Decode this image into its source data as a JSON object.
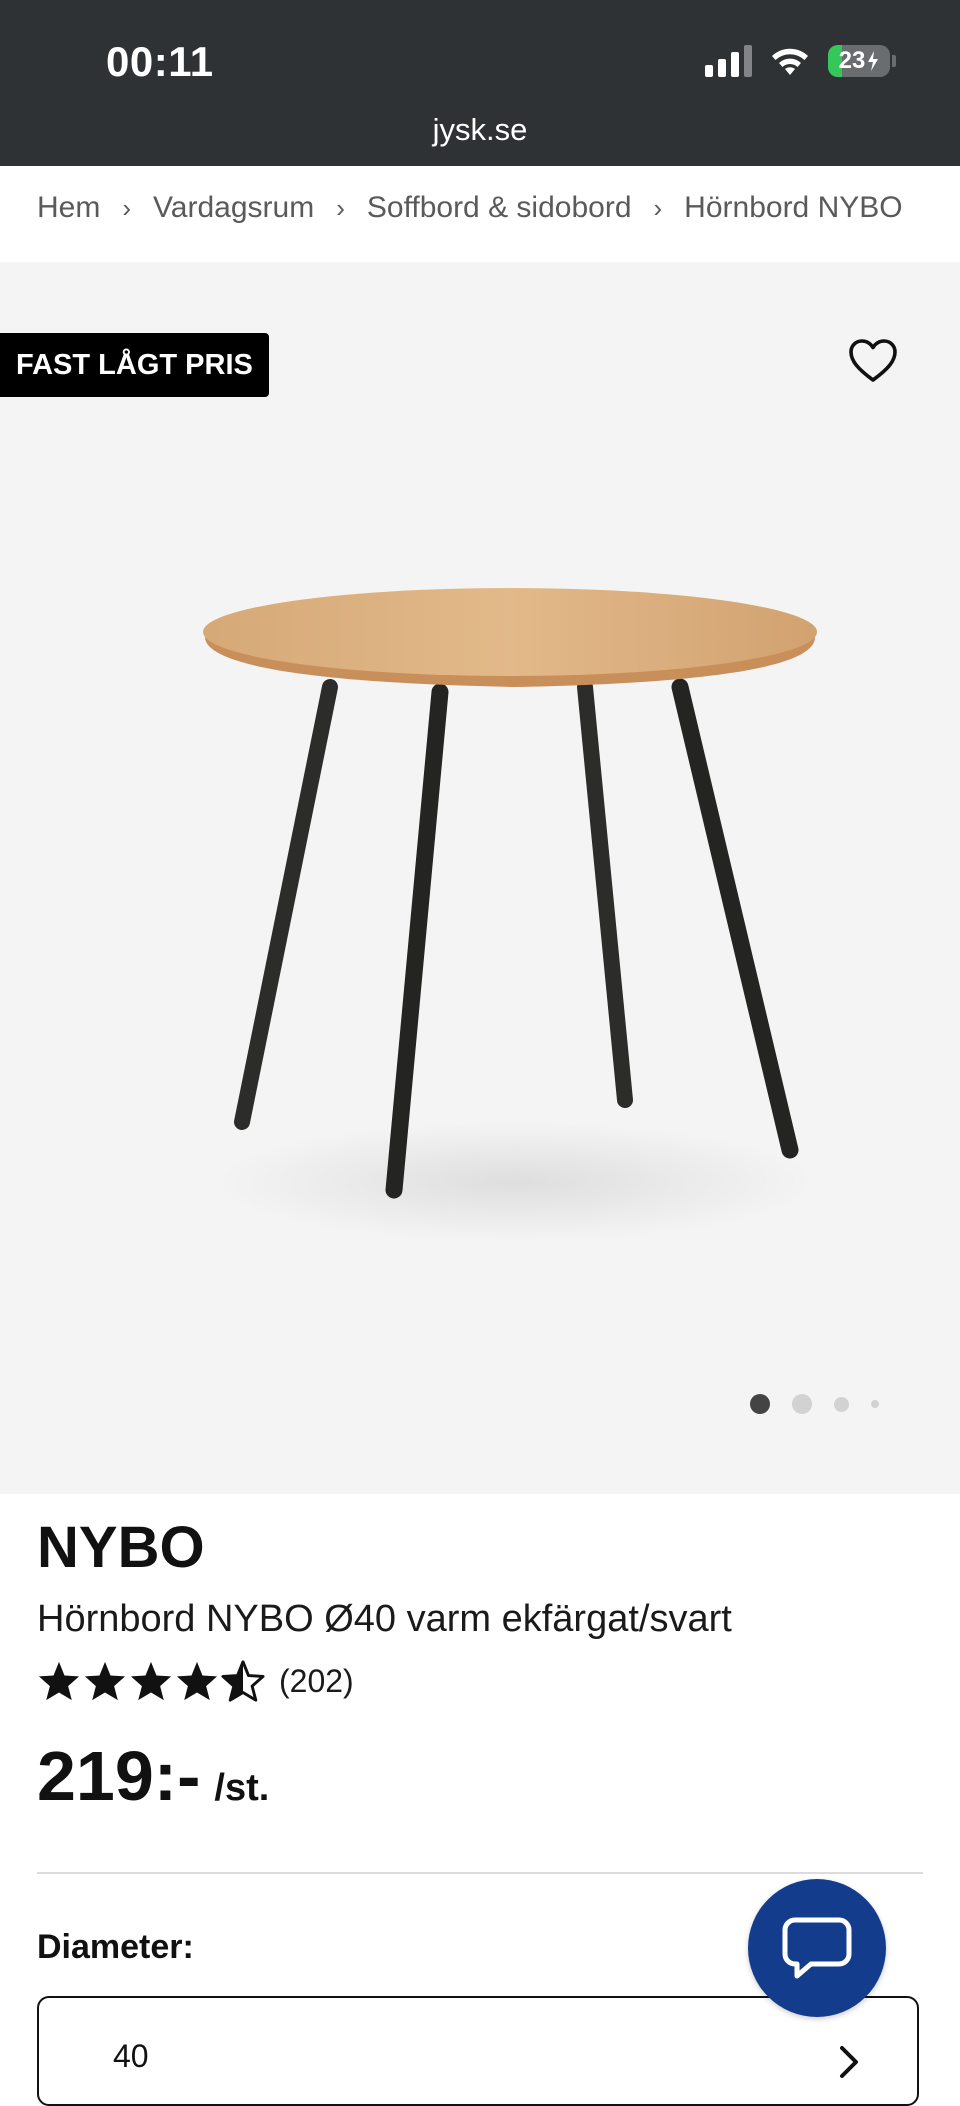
{
  "status_bar": {
    "time": "00:11",
    "battery_level": "23",
    "battery_charging": true,
    "url": "jysk.se"
  },
  "breadcrumb": {
    "items": [
      "Hem",
      "Vardagsrum",
      "Soffbord & sidobord",
      "Hörnbord NYBO"
    ]
  },
  "hero": {
    "badge": "FAST LÅGT PRIS",
    "favorite_icon": "heart-outline-icon",
    "image_count": 4,
    "active_image": 1
  },
  "product": {
    "brand": "NYBO",
    "title": "Hörnbord NYBO Ø40 varm ekfärgat/svart",
    "rating": 4.5,
    "rating_count": "(202)",
    "price": "219:-",
    "unit": "/st."
  },
  "options": {
    "diameter_label": "Diameter:",
    "diameter_value": "40"
  },
  "chat": {
    "icon": "chat-bubble-icon"
  },
  "colors": {
    "status_bar_bg": "#2f3234",
    "hero_bg": "#f4f4f4",
    "chat_button": "#143c8c",
    "badge_bg": "#000000"
  }
}
